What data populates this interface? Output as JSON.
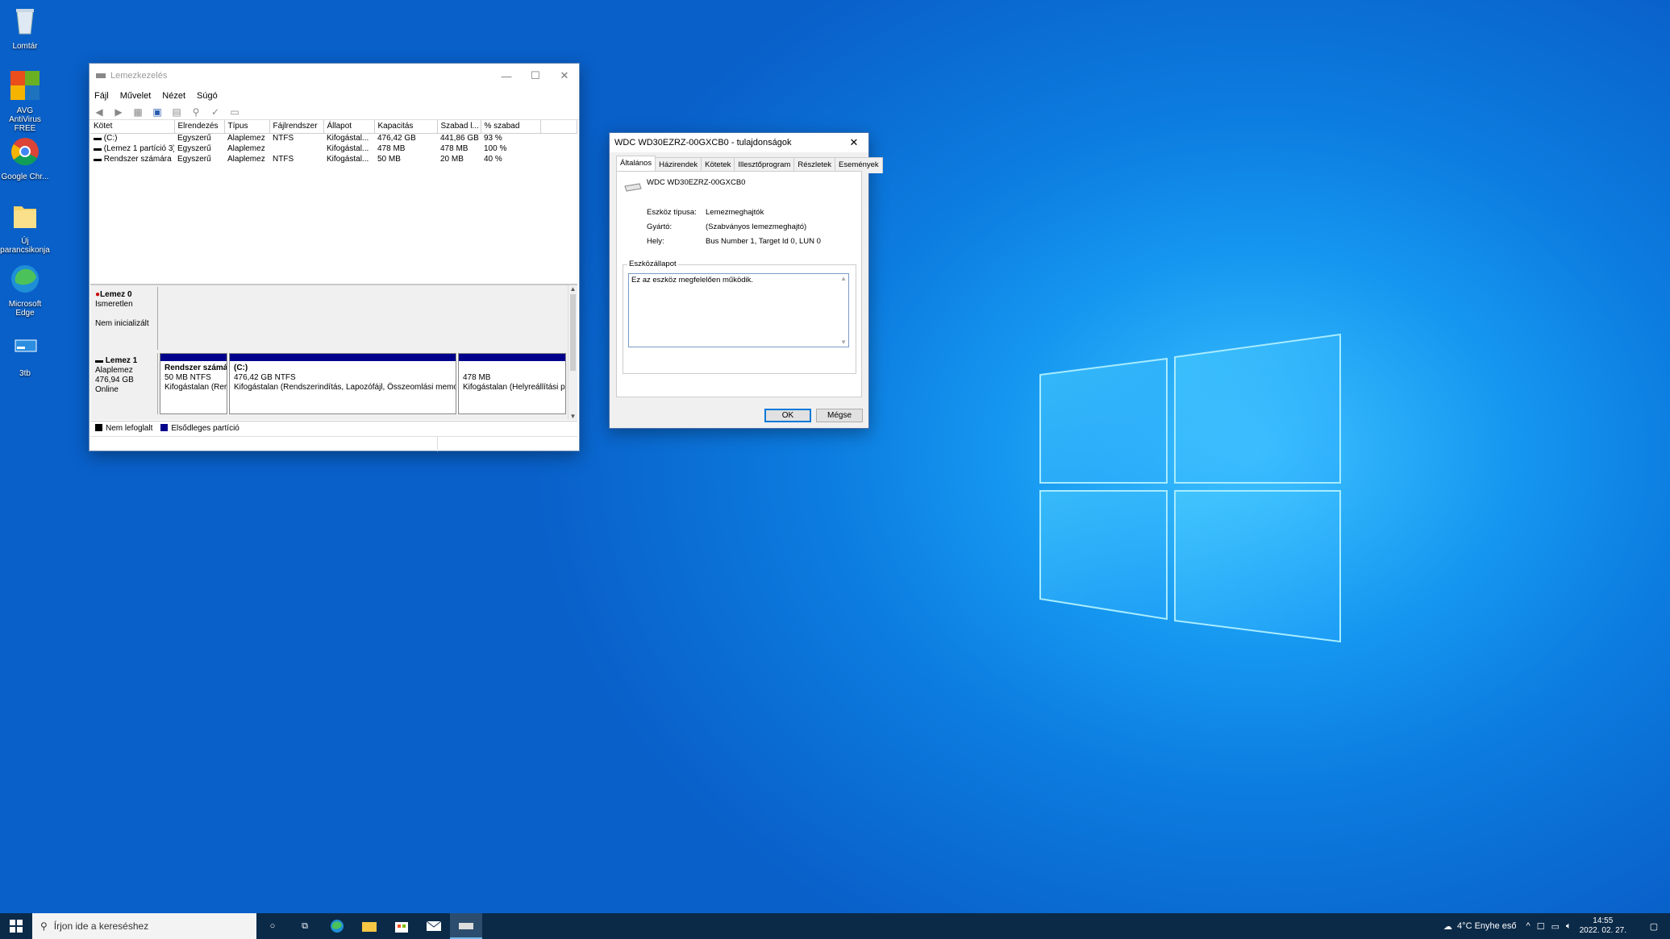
{
  "desktop": {
    "icons": [
      {
        "label": "Lomtár",
        "icon": "recycle-bin-icon"
      },
      {
        "label": "AVG AntiVirus FREE",
        "icon": "avg-icon"
      },
      {
        "label": "Google Chr...",
        "icon": "chrome-icon"
      },
      {
        "label": "Új parancsikonja",
        "icon": "folder-shortcut-icon"
      },
      {
        "label": "Microsoft Edge",
        "icon": "edge-icon"
      },
      {
        "label": "3tb",
        "icon": "drive-shortcut-icon"
      }
    ]
  },
  "disk_management": {
    "title": "Lemezkezelés",
    "menu": [
      "Fájl",
      "Művelet",
      "Nézet",
      "Súgó"
    ],
    "columns": [
      "Kötet",
      "Elrendezés",
      "Típus",
      "Fájlrendszer",
      "Állapot",
      "Kapacitás",
      "Szabad l...",
      "% szabad"
    ],
    "rows": [
      [
        "(C:)",
        "Egyszerű",
        "Alaplemez",
        "NTFS",
        "Kifogástal...",
        "476,42 GB",
        "441,86 GB",
        "93 %"
      ],
      [
        "(Lemez 1 partíció 3)",
        "Egyszerű",
        "Alaplemez",
        "",
        "Kifogástal...",
        "478 MB",
        "478 MB",
        "100 %"
      ],
      [
        "Rendszer számára ...",
        "Egyszerű",
        "Alaplemez",
        "NTFS",
        "Kifogástal...",
        "50 MB",
        "20 MB",
        "40 %"
      ]
    ],
    "disk0": {
      "name": "Lemez 0",
      "line1": "Ismeretlen",
      "line2": "Nem inicializált"
    },
    "disk1": {
      "name": "Lemez 1",
      "line1": "Alaplemez",
      "line2": "476,94 GB",
      "line3": "Online",
      "partitions": [
        {
          "name": "Rendszer számá",
          "size": "50 MB NTFS",
          "status": "Kifogástalan (Rer"
        },
        {
          "name": "(C:)",
          "size": "476,42 GB NTFS",
          "status": "Kifogástalan (Rendszerindítás, Lapozófájl, Összeomlási memória"
        },
        {
          "name": "",
          "size": "478 MB",
          "status": "Kifogástalan (Helyreállítási pa"
        }
      ]
    },
    "legend": [
      {
        "label": "Nem lefoglalt",
        "color": "#000000"
      },
      {
        "label": "Elsődleges partíció",
        "color": "#00008b"
      }
    ]
  },
  "properties": {
    "title": "WDC WD30EZRZ-00GXCB0 - tulajdonságok",
    "tabs": [
      "Általános",
      "Házirendek",
      "Kötetek",
      "Illesztőprogram",
      "Részletek",
      "Események"
    ],
    "device_name": "WDC WD30EZRZ-00GXCB0",
    "fields": [
      {
        "label": "Eszköz típusa:",
        "value": "Lemezmeghajtók"
      },
      {
        "label": "Gyártó:",
        "value": "(Szabványos lemezmeghajtó)"
      },
      {
        "label": "Hely:",
        "value": "Bus Number 1, Target Id 0, LUN 0"
      }
    ],
    "status_group": "Eszközállapot",
    "status_text": "Ez az eszköz megfelelően működik.",
    "ok": "OK",
    "cancel": "Mégse"
  },
  "taskbar": {
    "search_placeholder": "Írjon ide a kereséshez",
    "weather": "4°C  Enyhe eső",
    "time": "14:55",
    "date": "2022. 02. 27."
  }
}
